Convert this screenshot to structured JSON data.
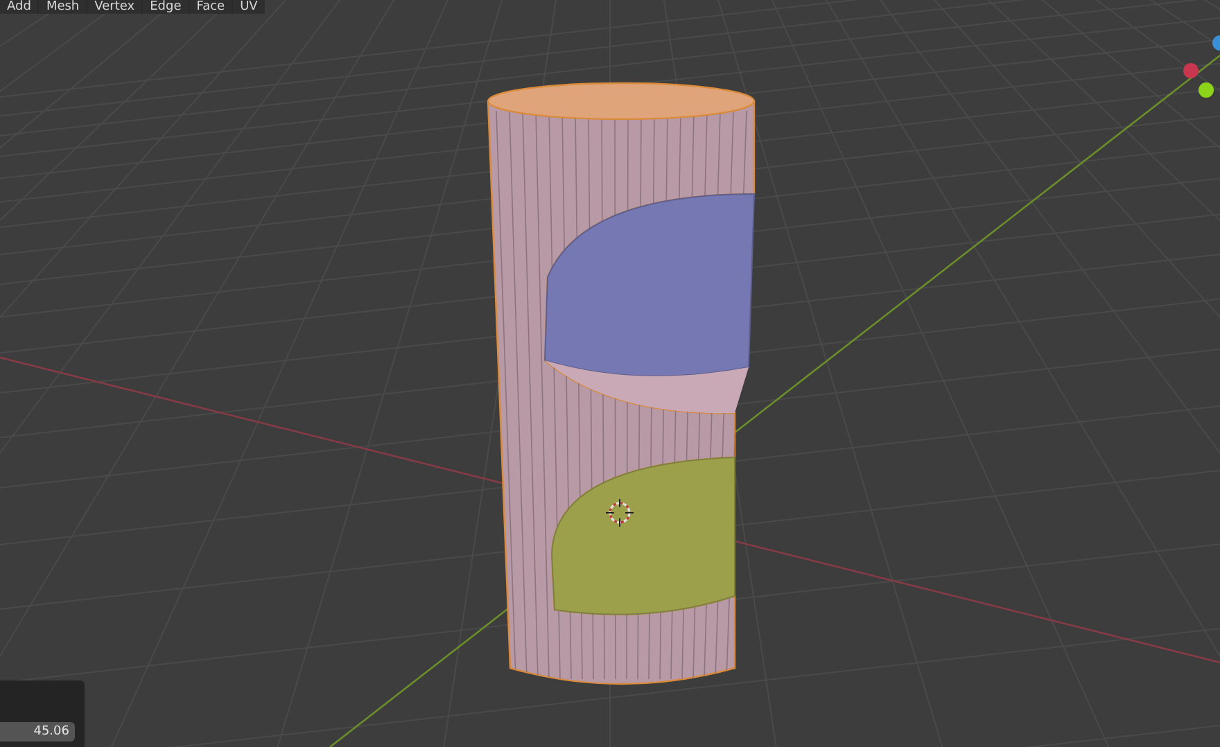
{
  "menu": [
    {
      "label": "Add"
    },
    {
      "label": "Mesh"
    },
    {
      "label": "Vertex"
    },
    {
      "label": "Edge"
    },
    {
      "label": "Face"
    },
    {
      "label": "UV"
    }
  ],
  "gizmo": {
    "axes": [
      {
        "color": "#3b8fd6"
      },
      {
        "color": "#c8374f"
      },
      {
        "color": "#8cd41a"
      }
    ]
  },
  "operator_panel": {
    "value": "45.06"
  }
}
